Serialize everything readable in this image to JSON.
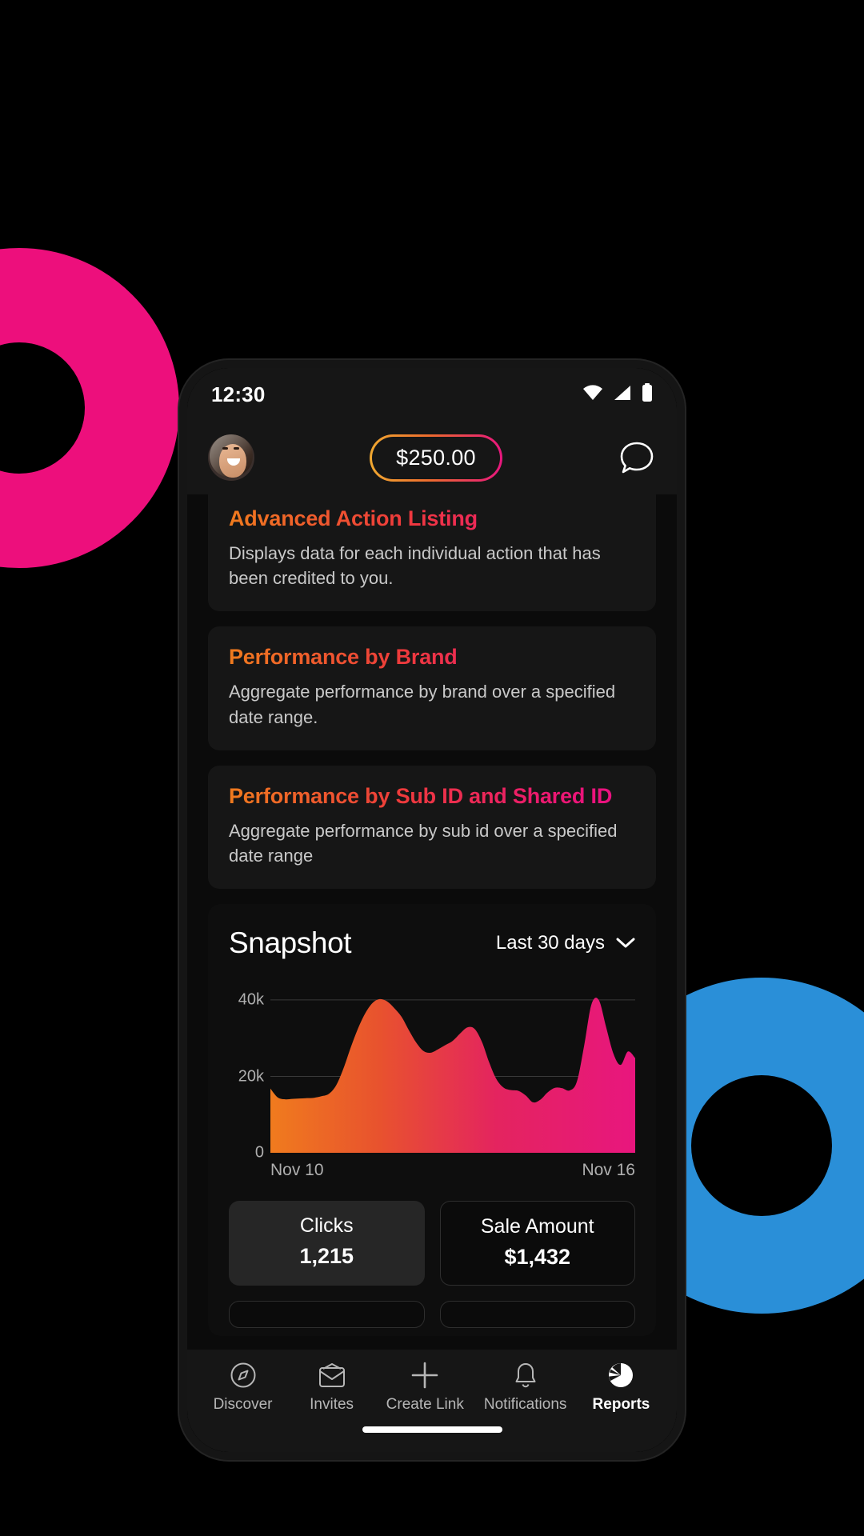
{
  "background": {
    "ring_left_color": "#ED0F7C",
    "ring_right_color": "#2A8FD8",
    "page_color": "#000000"
  },
  "status_bar": {
    "time": "12:30",
    "icons": [
      "wifi-icon",
      "cellular-signal-icon",
      "battery-icon"
    ]
  },
  "app_header": {
    "avatar_name": "user-avatar",
    "balance": "$250.00",
    "balance_gradient_start": "#F0A830",
    "balance_gradient_end": "#E8167E",
    "chat_icon": "chat-bubble-icon"
  },
  "report_cards": [
    {
      "title": "Advanced Action Listing",
      "description": "Displays data for each individual action that has been credited to you."
    },
    {
      "title": "Performance by Brand",
      "description": "Aggregate performance by brand over a specified date range."
    },
    {
      "title": "Performance by Sub ID and Shared ID",
      "description": "Aggregate performance by sub id over a specified date range"
    }
  ],
  "snapshot": {
    "title": "Snapshot",
    "range_label": "Last 30 days",
    "range_caret": "chevron-down-icon",
    "stats": [
      {
        "label": "Clicks",
        "value": "1,215",
        "style": "filled"
      },
      {
        "label": "Sale Amount",
        "value": "$1,432",
        "style": "outlined"
      }
    ]
  },
  "chart_data": {
    "type": "area",
    "title": "Snapshot",
    "xlabel": "",
    "ylabel": "",
    "ylim": [
      0,
      45000
    ],
    "yticks": [
      "0",
      "20k",
      "40k"
    ],
    "ytick_values": [
      0,
      20000,
      40000
    ],
    "xticks": [
      "Nov 10",
      "Nov 16"
    ],
    "grid": true,
    "legend": "none",
    "fill_gradient": [
      "#F07B1E",
      "#E8167E"
    ],
    "x": [
      0,
      2,
      4,
      6,
      8,
      10,
      12,
      14,
      16,
      18,
      20,
      22,
      24,
      26,
      28,
      30,
      32,
      34,
      36,
      38,
      40,
      42,
      44,
      46,
      48,
      50,
      52,
      54,
      56,
      58,
      60,
      62,
      64,
      66,
      68,
      70,
      72,
      74,
      76,
      78,
      80,
      82,
      84,
      86,
      88,
      90,
      92,
      94,
      96,
      98,
      100
    ],
    "values": [
      16800,
      14500,
      14000,
      14100,
      14200,
      14300,
      14400,
      14800,
      15400,
      17600,
      22000,
      27500,
      32500,
      36500,
      39200,
      40200,
      39600,
      37800,
      35500,
      32000,
      28800,
      26600,
      26200,
      27100,
      28200,
      29300,
      31200,
      32800,
      32400,
      29000,
      23600,
      19200,
      17000,
      16400,
      16200,
      15000,
      13200,
      13900,
      15800,
      17000,
      16900,
      16300,
      18600,
      28000,
      38800,
      40000,
      33000,
      26000,
      23000,
      26500,
      24800
    ]
  },
  "bottom_nav": {
    "items": [
      {
        "label": "Discover",
        "icon": "compass-icon",
        "active": false
      },
      {
        "label": "Invites",
        "icon": "envelope-icon",
        "active": false
      },
      {
        "label": "Create Link",
        "icon": "plus-icon",
        "active": false
      },
      {
        "label": "Notifications",
        "icon": "bell-icon",
        "active": false
      },
      {
        "label": "Reports",
        "icon": "pie-chart-icon",
        "active": true
      }
    ]
  }
}
